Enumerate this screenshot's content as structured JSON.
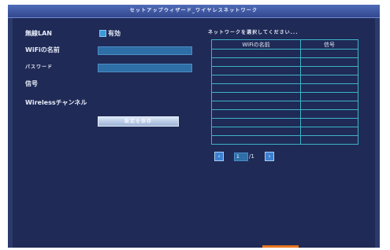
{
  "window": {
    "title": "セットアップウィザード_ワイヤレスネットワーク"
  },
  "form": {
    "wireless_lan_label": "無線LAN",
    "enabled_label": "有効",
    "wifi_name_label": "WiFiの名前",
    "wifi_name_value": "",
    "password_label": "パスワード",
    "password_value": "",
    "signal_label": "信号",
    "channel_label": "Wirelessチャンネル",
    "apply_button": "設定を保存"
  },
  "network_list": {
    "title": "ネットワークを選択してください...",
    "columns": [
      "WiFiの名前",
      "信号"
    ],
    "rows": []
  },
  "pager": {
    "current_page": "1",
    "total_pages": "/1"
  },
  "colors": {
    "background": "#1f2a56",
    "accent": "#3c9ad8",
    "table_border": "#3fb3c9",
    "orange_tab": "#e8761e"
  }
}
